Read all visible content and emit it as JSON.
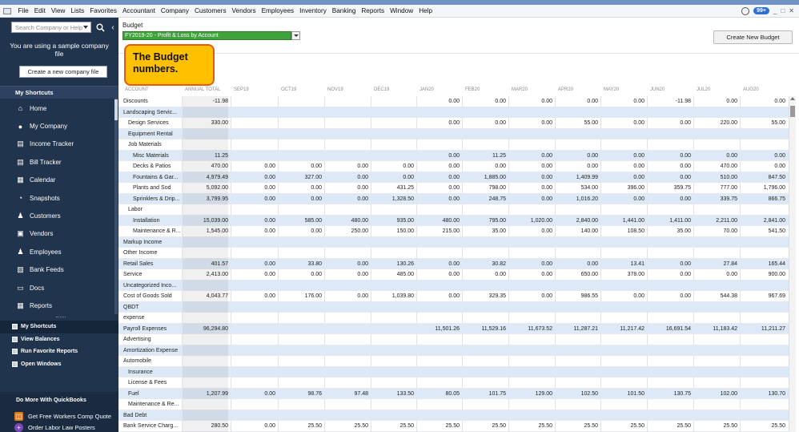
{
  "menu": [
    "File",
    "Edit",
    "View",
    "Lists",
    "Favorites",
    "Accountant",
    "Company",
    "Customers",
    "Vendors",
    "Employees",
    "Inventory",
    "Banking",
    "Reports",
    "Window",
    "Help"
  ],
  "notification_count": "99+",
  "sidebar": {
    "search_placeholder": "Search Company or Help",
    "sample_text": "You are using a sample company file",
    "create_company_label": "Create a new company file",
    "shortcuts_header": "My Shortcuts",
    "items": [
      {
        "label": "Home",
        "icon": "home-icon"
      },
      {
        "label": "My Company",
        "icon": "my-company-icon"
      },
      {
        "label": "Income Tracker",
        "icon": "income-tracker-icon"
      },
      {
        "label": "Bill Tracker",
        "icon": "bill-tracker-icon"
      },
      {
        "label": "Calendar",
        "icon": "calendar-icon"
      },
      {
        "label": "Snapshots",
        "icon": "snapshots-icon"
      },
      {
        "label": "Customers",
        "icon": "customers-icon"
      },
      {
        "label": "Vendors",
        "icon": "vendors-icon"
      },
      {
        "label": "Employees",
        "icon": "employees-icon"
      },
      {
        "label": "Bank Feeds",
        "icon": "bank-feeds-icon"
      },
      {
        "label": "Docs",
        "icon": "docs-icon"
      },
      {
        "label": "Reports",
        "icon": "reports-icon"
      }
    ],
    "lower": [
      "My Shortcuts",
      "View Balances",
      "Run Favorite Reports",
      "Open Windows"
    ],
    "do_more_header": "Do More With QuickBooks",
    "promo": [
      "Get Free Workers Comp Quote",
      "Order Labor Law Posters"
    ]
  },
  "budget": {
    "label": "Budget",
    "selected": "FY2019-20 - Profit & Loss by Account",
    "create_button": "Create New Budget",
    "callout": "The Budget numbers."
  },
  "table": {
    "columns": [
      "ACCOUNT",
      "ANNUAL TOTAL",
      "SEP19",
      "OCT19",
      "NOV19",
      "DEC19",
      "JAN20",
      "FEB20",
      "MAR20",
      "APR20",
      "MAY20",
      "JUN20",
      "JUL20",
      "AUG20"
    ],
    "rows": [
      {
        "account": "Discounts",
        "indent": 0,
        "values": [
          "-11.98",
          "",
          "",
          "",
          "",
          "0.00",
          "0.00",
          "0.00",
          "0.00",
          "0.00",
          "-11.98",
          "0.00",
          "0.00"
        ]
      },
      {
        "account": "Landscaping Servic...",
        "indent": 0,
        "values": [
          "",
          "",
          "",
          "",
          "",
          "",
          "",
          "",
          "",
          "",
          "",
          "",
          ""
        ]
      },
      {
        "account": "Design Services",
        "indent": 1,
        "values": [
          "330.00",
          "",
          "",
          "",
          "",
          "0.00",
          "0.00",
          "0.00",
          "55.00",
          "0.00",
          "0.00",
          "220.00",
          "55.00"
        ]
      },
      {
        "account": "Equipment Rental",
        "indent": 1,
        "values": [
          "",
          "",
          "",
          "",
          "",
          "",
          "",
          "",
          "",
          "",
          "",
          "",
          ""
        ]
      },
      {
        "account": "Job Materials",
        "indent": 1,
        "values": [
          "",
          "",
          "",
          "",
          "",
          "",
          "",
          "",
          "",
          "",
          "",
          "",
          ""
        ]
      },
      {
        "account": "Misc Materials",
        "indent": 2,
        "values": [
          "11.25",
          "",
          "",
          "",
          "",
          "0.00",
          "11.25",
          "0.00",
          "0.00",
          "0.00",
          "0.00",
          "0.00",
          "0.00"
        ]
      },
      {
        "account": "Decks & Patios",
        "indent": 2,
        "values": [
          "470.00",
          "0.00",
          "0.00",
          "0.00",
          "0.00",
          "0.00",
          "0.00",
          "0.00",
          "0.00",
          "0.00",
          "0.00",
          "470.00",
          "0.00"
        ]
      },
      {
        "account": "Fountains & Gar...",
        "indent": 2,
        "values": [
          "4,979.49",
          "0.00",
          "327.00",
          "0.00",
          "0.00",
          "0.00",
          "1,885.00",
          "0.00",
          "1,409.99",
          "0.00",
          "0.00",
          "510.00",
          "847.50"
        ]
      },
      {
        "account": "Plants and Sod",
        "indent": 2,
        "values": [
          "5,092.00",
          "0.00",
          "0.00",
          "0.00",
          "431.25",
          "0.00",
          "798.00",
          "0.00",
          "534.00",
          "396.00",
          "359.75",
          "777.00",
          "1,796.00"
        ]
      },
      {
        "account": "Sprinklers & Drip...",
        "indent": 2,
        "values": [
          "3,799.95",
          "0.00",
          "0.00",
          "0.00",
          "1,328.50",
          "0.00",
          "248.75",
          "0.00",
          "1,016.20",
          "0.00",
          "0.00",
          "339.75",
          "866.75"
        ]
      },
      {
        "account": "Labor",
        "indent": 1,
        "values": [
          "",
          "",
          "",
          "",
          "",
          "",
          "",
          "",
          "",
          "",
          "",
          "",
          ""
        ]
      },
      {
        "account": "Installation",
        "indent": 2,
        "values": [
          "15,039.00",
          "0.00",
          "585.00",
          "480.00",
          "935.00",
          "480.00",
          "795.00",
          "1,020.00",
          "2,840.00",
          "1,441.00",
          "1,411.00",
          "2,211.00",
          "2,841.00"
        ]
      },
      {
        "account": "Maintenance & R...",
        "indent": 2,
        "values": [
          "1,545.00",
          "0.00",
          "0.00",
          "250.00",
          "150.00",
          "215.00",
          "35.00",
          "0.00",
          "140.00",
          "108.50",
          "35.00",
          "70.00",
          "541.50"
        ]
      },
      {
        "account": "Markup Income",
        "indent": 0,
        "values": [
          "",
          "",
          "",
          "",
          "",
          "",
          "",
          "",
          "",
          "",
          "",
          "",
          ""
        ]
      },
      {
        "account": "Other Income",
        "indent": 0,
        "values": [
          "",
          "",
          "",
          "",
          "",
          "",
          "",
          "",
          "",
          "",
          "",
          "",
          ""
        ]
      },
      {
        "account": "Retail Sales",
        "indent": 0,
        "values": [
          "401.57",
          "0.00",
          "33.80",
          "0.00",
          "130.26",
          "0.00",
          "30.82",
          "0.00",
          "0.00",
          "13.41",
          "0.00",
          "27.84",
          "165.44"
        ]
      },
      {
        "account": "Service",
        "indent": 0,
        "values": [
          "2,413.00",
          "0.00",
          "0.00",
          "0.00",
          "485.00",
          "0.00",
          "0.00",
          "0.00",
          "650.00",
          "378.00",
          "0.00",
          "0.00",
          "900.00"
        ]
      },
      {
        "account": "Uncategorized Inco...",
        "indent": 0,
        "values": [
          "",
          "",
          "",
          "",
          "",
          "",
          "",
          "",
          "",
          "",
          "",
          "",
          ""
        ]
      },
      {
        "account": "Cost of Goods Sold",
        "indent": 0,
        "values": [
          "4,043.77",
          "0.00",
          "176.00",
          "0.00",
          "1,039.80",
          "0.00",
          "329.35",
          "0.00",
          "986.55",
          "0.00",
          "0.00",
          "544.38",
          "967.69"
        ]
      },
      {
        "account": "QBDT",
        "indent": 0,
        "values": [
          "",
          "",
          "",
          "",
          "",
          "",
          "",
          "",
          "",
          "",
          "",
          "",
          ""
        ]
      },
      {
        "account": "expense",
        "indent": 0,
        "values": [
          "",
          "",
          "",
          "",
          "",
          "",
          "",
          "",
          "",
          "",
          "",
          "",
          ""
        ]
      },
      {
        "account": "Payroll Expenses",
        "indent": 0,
        "values": [
          "96,294.80",
          "",
          "",
          "",
          "",
          "11,501.26",
          "11,529.16",
          "11,673.52",
          "11,287.21",
          "11,217.42",
          "16,691.54",
          "11,183.42",
          "11,211.27"
        ]
      },
      {
        "account": "Advertising",
        "indent": 0,
        "values": [
          "",
          "",
          "",
          "",
          "",
          "",
          "",
          "",
          "",
          "",
          "",
          "",
          ""
        ]
      },
      {
        "account": "Amortization Expense",
        "indent": 0,
        "values": [
          "",
          "",
          "",
          "",
          "",
          "",
          "",
          "",
          "",
          "",
          "",
          "",
          ""
        ]
      },
      {
        "account": "Automobile",
        "indent": 0,
        "values": [
          "",
          "",
          "",
          "",
          "",
          "",
          "",
          "",
          "",
          "",
          "",
          "",
          ""
        ]
      },
      {
        "account": "Insurance",
        "indent": 1,
        "values": [
          "",
          "",
          "",
          "",
          "",
          "",
          "",
          "",
          "",
          "",
          "",
          "",
          ""
        ]
      },
      {
        "account": "License & Fees",
        "indent": 1,
        "values": [
          "",
          "",
          "",
          "",
          "",
          "",
          "",
          "",
          "",
          "",
          "",
          "",
          ""
        ]
      },
      {
        "account": "Fuel",
        "indent": 1,
        "values": [
          "1,207.99",
          "0.00",
          "98.76",
          "97.48",
          "133.50",
          "80.05",
          "101.75",
          "129.00",
          "102.50",
          "101.50",
          "130.75",
          "102.00",
          "130.70"
        ]
      },
      {
        "account": "Maintenance & Re...",
        "indent": 1,
        "values": [
          "",
          "",
          "",
          "",
          "",
          "",
          "",
          "",
          "",
          "",
          "",
          "",
          ""
        ]
      },
      {
        "account": "Bad Debt",
        "indent": 0,
        "values": [
          "",
          "",
          "",
          "",
          "",
          "",
          "",
          "",
          "",
          "",
          "",
          "",
          ""
        ]
      },
      {
        "account": "Bank Service Charg...",
        "indent": 0,
        "values": [
          "280.50",
          "0.00",
          "25.50",
          "25.50",
          "25.50",
          "25.50",
          "25.50",
          "25.50",
          "25.50",
          "25.50",
          "25.50",
          "25.50",
          "25.50"
        ]
      }
    ]
  }
}
